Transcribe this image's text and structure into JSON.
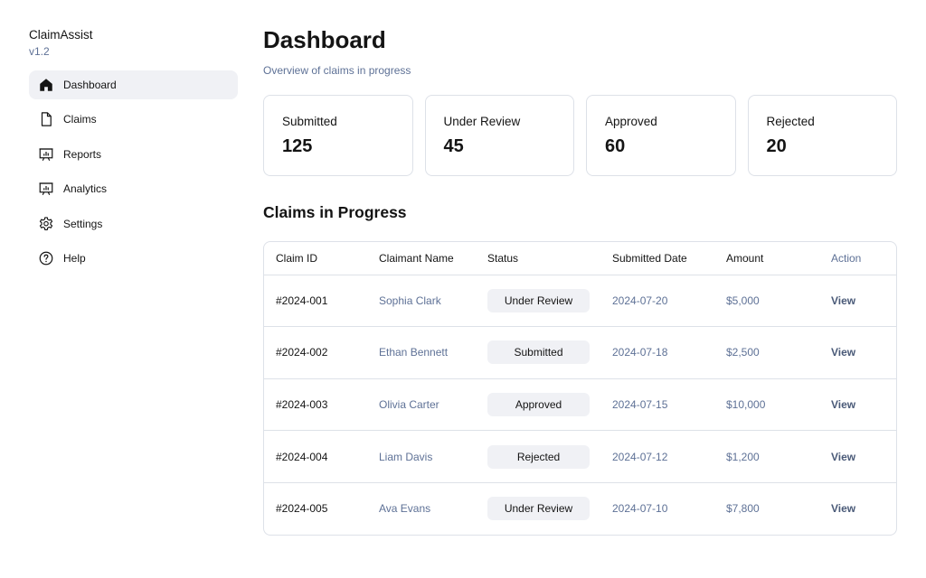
{
  "app": {
    "name": "ClaimAssist",
    "version": "v1.2"
  },
  "sidebar": {
    "items": [
      {
        "label": "Dashboard",
        "icon": "home-icon",
        "active": true
      },
      {
        "label": "Claims",
        "icon": "document-icon",
        "active": false
      },
      {
        "label": "Reports",
        "icon": "presentation-chart-icon",
        "active": false
      },
      {
        "label": "Analytics",
        "icon": "presentation-chart-icon",
        "active": false
      },
      {
        "label": "Settings",
        "icon": "gear-icon",
        "active": false
      },
      {
        "label": "Help",
        "icon": "question-circle-icon",
        "active": false
      }
    ]
  },
  "main": {
    "title": "Dashboard",
    "subtitle": "Overview of claims in progress",
    "stats": [
      {
        "label": "Submitted",
        "value": "125"
      },
      {
        "label": "Under Review",
        "value": "45"
      },
      {
        "label": "Approved",
        "value": "60"
      },
      {
        "label": "Rejected",
        "value": "20"
      }
    ],
    "section_title": "Claims in Progress",
    "table": {
      "headers": [
        "Claim ID",
        "Claimant Name",
        "Status",
        "Submitted Date",
        "Amount",
        "Action"
      ],
      "rows": [
        {
          "id": "#2024-001",
          "name": "Sophia Clark",
          "status": "Under Review",
          "date": "2024-07-20",
          "amount": "$5,000",
          "action": "View"
        },
        {
          "id": "#2024-002",
          "name": "Ethan Bennett",
          "status": "Submitted",
          "date": "2024-07-18",
          "amount": "$2,500",
          "action": "View"
        },
        {
          "id": "#2024-003",
          "name": "Olivia Carter",
          "status": "Approved",
          "date": "2024-07-15",
          "amount": "$10,000",
          "action": "View"
        },
        {
          "id": "#2024-004",
          "name": "Liam Davis",
          "status": "Rejected",
          "date": "2024-07-12",
          "amount": "$1,200",
          "action": "View"
        },
        {
          "id": "#2024-005",
          "name": "Ava Evans",
          "status": "Under Review",
          "date": "2024-07-10",
          "amount": "$7,800",
          "action": "View"
        }
      ]
    }
  },
  "colors": {
    "text": "#141414",
    "muted": "#5e7196",
    "border": "#dde1e8",
    "pill_bg": "#f0f1f5",
    "active_nav_bg": "#f0f1f5"
  }
}
